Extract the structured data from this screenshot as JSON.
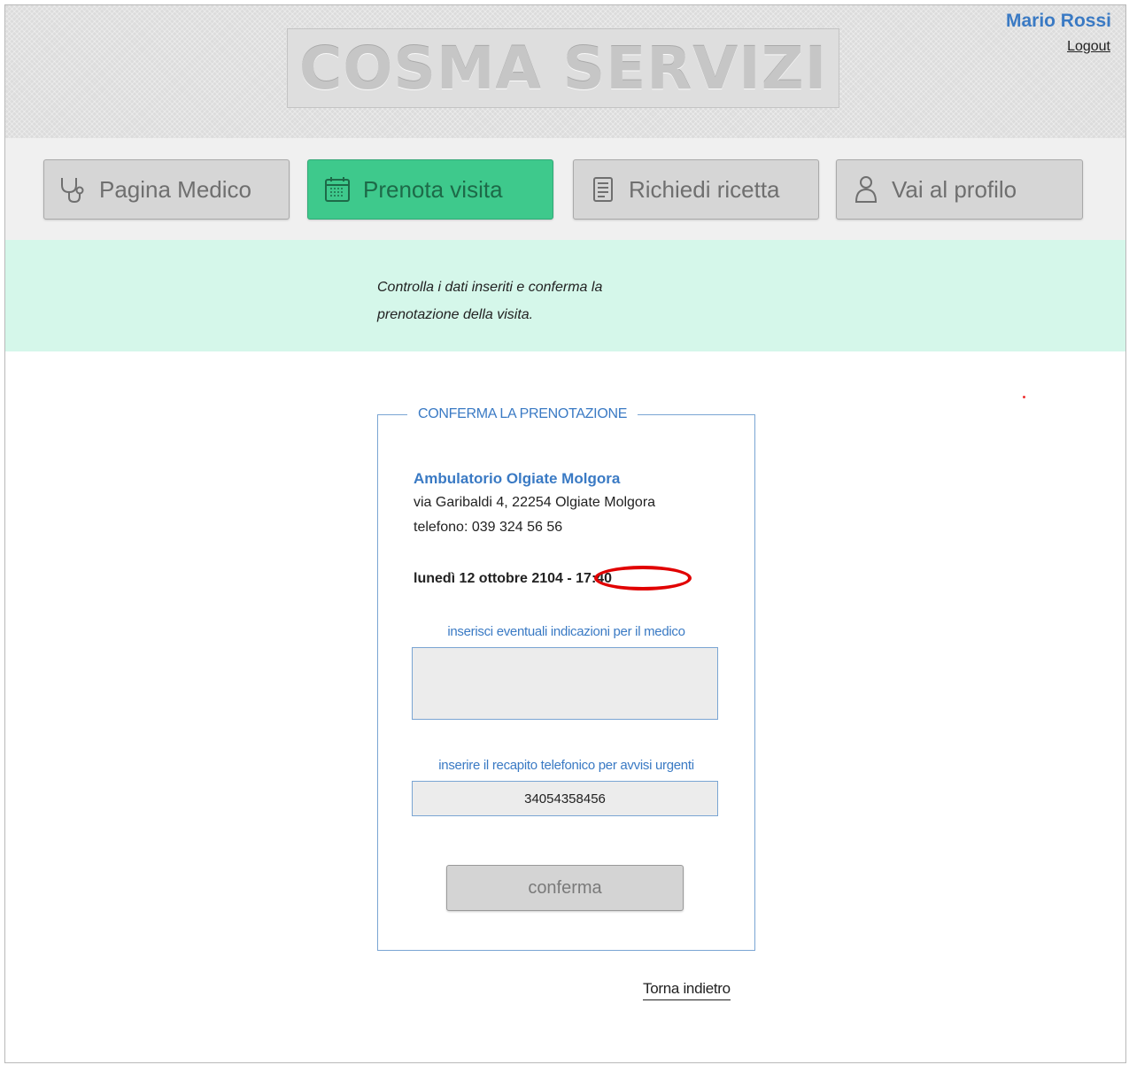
{
  "header": {
    "logo_text": "COSMA SERVIZI",
    "user_name": "Mario Rossi",
    "logout_label": "Logout"
  },
  "nav": {
    "items": [
      {
        "label": "Pagina Medico",
        "icon": "stethoscope-icon"
      },
      {
        "label": "Prenota visita",
        "icon": "calendar-icon",
        "active": true
      },
      {
        "label": "Richiedi ricetta",
        "icon": "document-icon"
      },
      {
        "label": "Vai al profilo",
        "icon": "user-icon"
      }
    ]
  },
  "info": {
    "line1": "Controlla i dati inseriti e conferma la",
    "line2": "prenotazione della visita."
  },
  "booking": {
    "legend": "CONFERMA LA PRENOTAZIONE",
    "clinic_name": "Ambulatorio Olgiate Molgora",
    "clinic_address": "via Garibaldi 4, 22254 Olgiate Molgora",
    "clinic_phone": "telefono: 039 324 56 56",
    "appointment": "lunedì 12 ottobre 2104 - 17:40",
    "notes_label": "inserisci eventuali indicazioni per il medico",
    "notes_value": "",
    "phone_label": "inserire il recapito telefonico per avvisi urgenti",
    "phone_value": "34054358456",
    "confirm_label": "conferma"
  },
  "footer": {
    "back_label": "Torna indietro"
  },
  "colors": {
    "accent_blue": "#3a7ac4",
    "active_green": "#3ec98c",
    "info_band": "#d5f7ea",
    "highlight_red": "#e10000"
  }
}
